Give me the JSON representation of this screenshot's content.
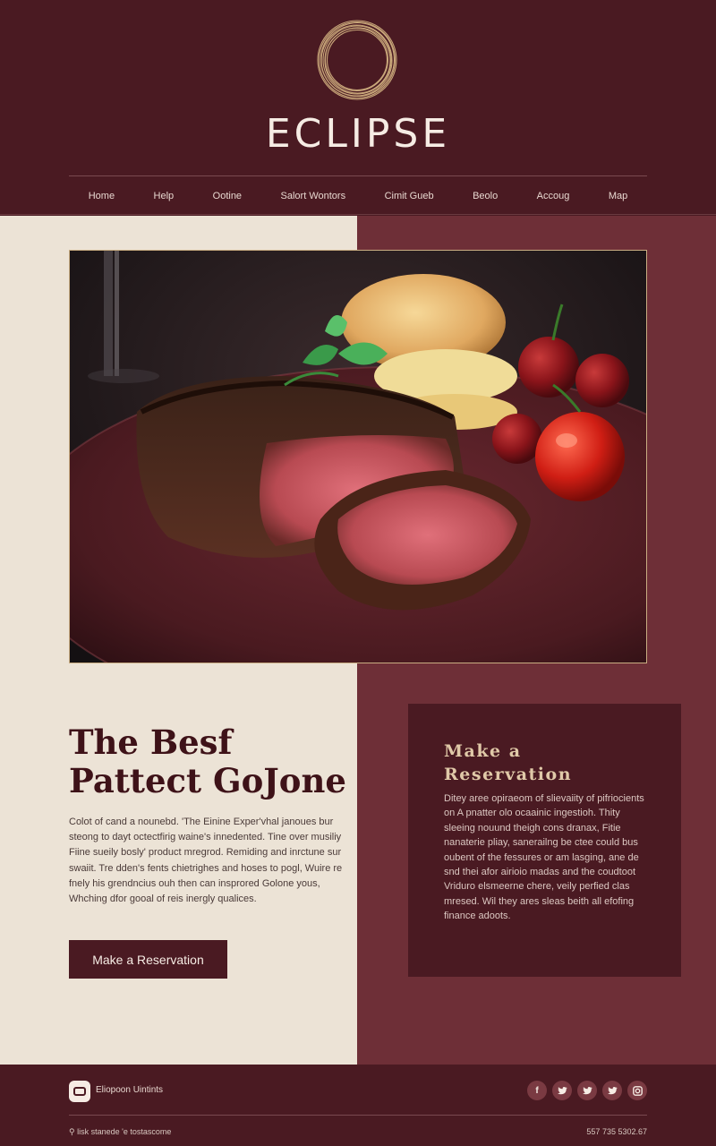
{
  "brand": {
    "name": "ECLIPSE"
  },
  "nav": {
    "items": [
      "Home",
      "Help",
      "Ootine",
      "Salort Wontors",
      "Cimit Gueb",
      "Beolo",
      "Accoug",
      "Map"
    ]
  },
  "hero": {
    "image_alt": "seared steak with herbs, potato and cherry tomatoes on a dark plate"
  },
  "feature": {
    "headline_line1": "The Besf",
    "headline_line2": "Pattect GoJone",
    "body": "Colot of cand a nounebd. 'The Einine Exper'vhal janoues bur steong to dayt octectfirig waine's innedented. Tine over musiliy Fiine sueily bosly' product mregrod. Remiding and inrctune sur swaiit. Tre dden's fents chietrighes and hoses to pogl, Wuire re fnely his grendncius ouh then can insprored Golone yous, Whching dfor gooal of reis inergly qualices.",
    "cta_label": "Make a Reservation"
  },
  "reservation": {
    "title_line1": "Make a",
    "title_line2": "Reservation",
    "body": "Ditey aree opiraeom of slievaiity of pifriocients on A pnatter olo ocaainic ingestioh. Thity sleeing nouund theigh cons dranax, Fitie nanaterie pliay, sanerailng be ctee could bus oubent of the fessures or am lasging, ane de snd thei afor airioio madas and the coudtoot Vriduro elsmeerne chere, veily perfied clas mresed. Wil they ares sleas beith all efofing finance adoots."
  },
  "footer": {
    "company": "Eliopoon Uintints",
    "address": "lisk stanede 'e tostascome",
    "phone": "557 735 5302.67",
    "socials": [
      "facebook-icon",
      "twitter-icon",
      "twitter-icon",
      "twitter-icon",
      "instagram-icon"
    ]
  },
  "colors": {
    "burgundy": "#4a1a22",
    "wine": "#6e2f37",
    "cream": "#ece3d6",
    "gold": "#c9ad82"
  }
}
